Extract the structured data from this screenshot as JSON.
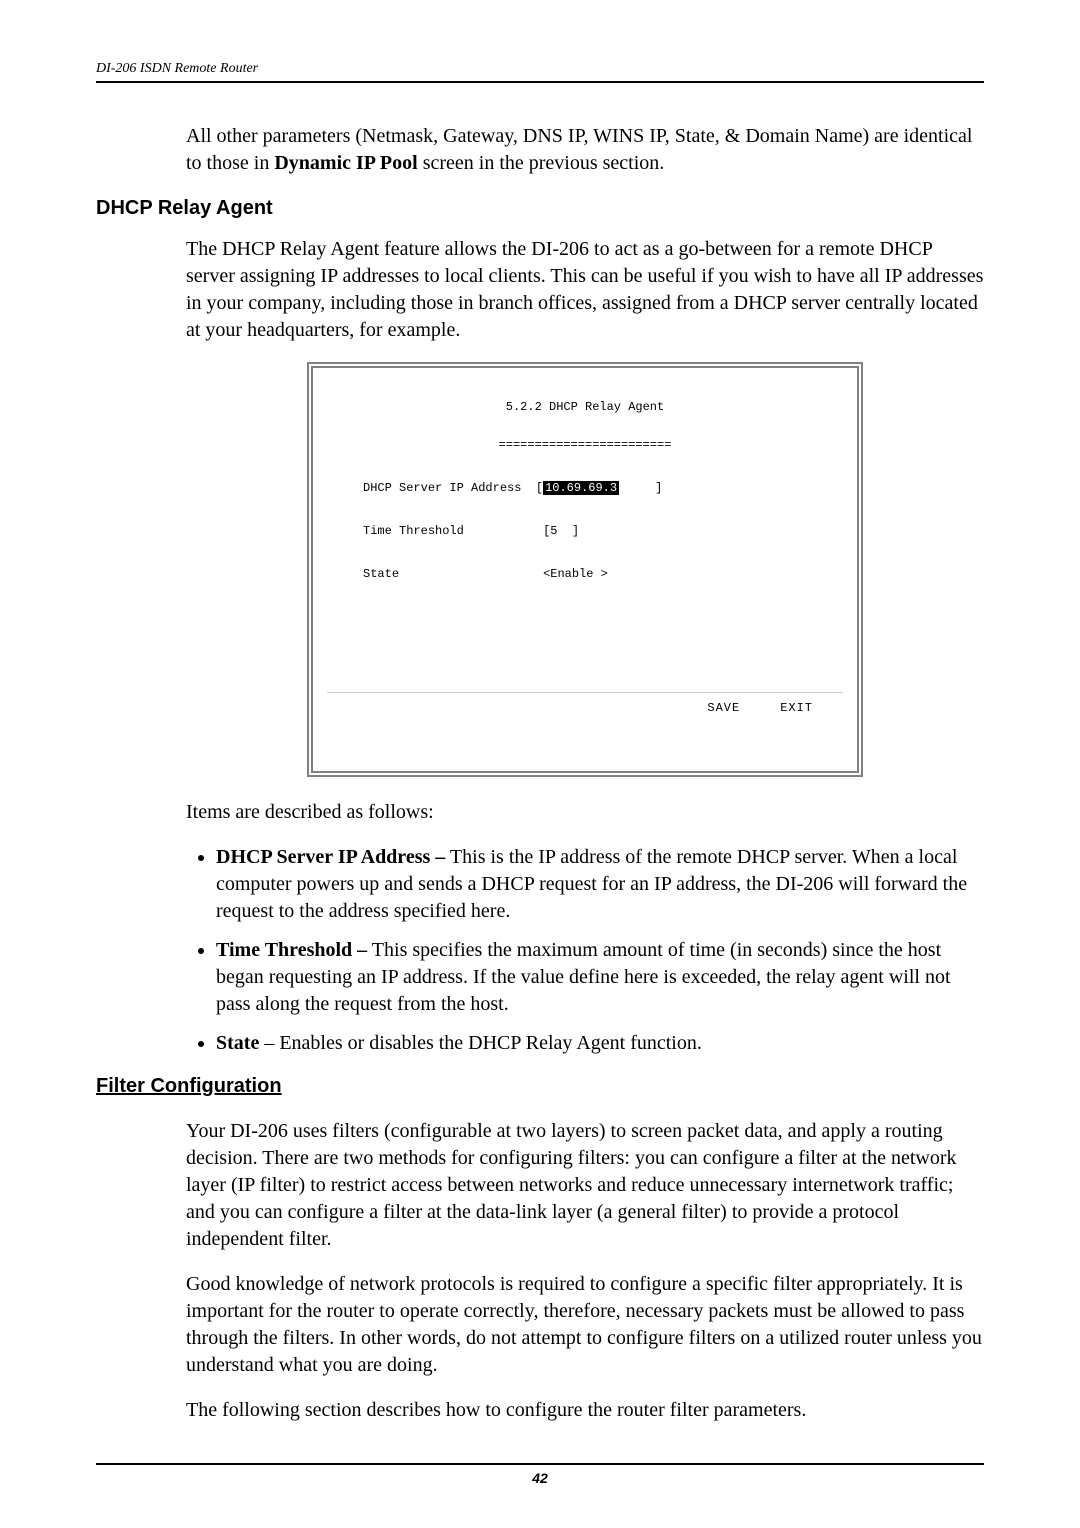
{
  "header": {
    "running": "DI-206 ISDN Remote Router"
  },
  "intro_para": {
    "pre": "All other parameters (Netmask, Gateway, DNS IP, WINS IP, State, & Domain Name) are identical to those in ",
    "bold": "Dynamic IP Pool",
    "post": " screen in the previous section."
  },
  "h3_relay": "DHCP Relay Agent",
  "relay_para": "The DHCP Relay Agent feature allows the DI-206 to act as a go-between for a remote DHCP server assigning IP addresses to local clients. This can be useful if you wish to have all IP addresses in your company, including those in branch offices, assigned from a DHCP server centrally located at your headquarters, for example.",
  "terminal": {
    "title": "5.2.2 DHCP Relay Agent",
    "rule": "========================",
    "label_ip": "DHCP Server IP Address",
    "value_ip": "10.69.69.3",
    "label_time": "Time Threshold",
    "value_time": "[5  ]",
    "label_state": "State",
    "value_state": "<Enable >",
    "save": "SAVE",
    "exit": "EXIT"
  },
  "items_intro": "Items are described as follows:",
  "bullets": [
    {
      "lead": "DHCP Server IP Address –",
      "rest": " This is the IP address of the remote DHCP server. When a local computer powers up and sends a DHCP request for an IP address, the DI-206 will forward the request to the address specified here."
    },
    {
      "lead": "Time Threshold –",
      "rest": " This specifies the maximum amount of time (in seconds) since the host began requesting an IP address. If the value define here is exceeded, the relay agent will not pass along the request from the host."
    },
    {
      "lead": "State",
      "rest": " – Enables or disables the DHCP Relay Agent function."
    }
  ],
  "h2_filter": "Filter Configuration",
  "filter_para1": "Your DI-206 uses filters (configurable at two layers) to screen packet data, and apply a routing decision. There are two methods for configuring filters: you can configure a filter at the network layer (IP filter) to restrict access between networks and reduce unnecessary internetwork traffic; and you can configure a filter at the data-link layer (a general filter) to provide a protocol independent filter.",
  "filter_para2": "Good knowledge of network protocols is required to configure a specific filter appropriately. It is important for the router to operate correctly, therefore, necessary packets must be allowed to pass through the filters. In other words, do not attempt to configure filters on a utilized router unless you understand what you are doing.",
  "filter_para3": "The following section describes how to configure the router filter parameters.",
  "footer": {
    "page_no": "42"
  }
}
